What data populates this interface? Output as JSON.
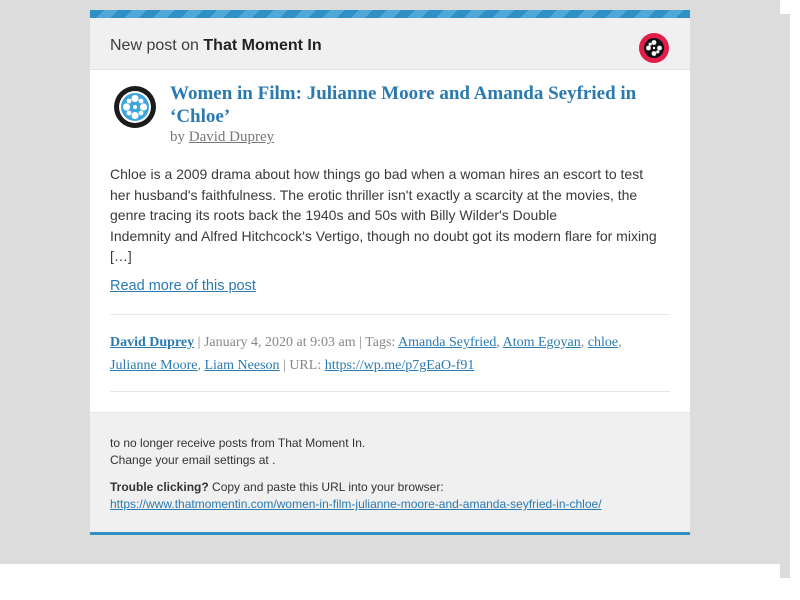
{
  "header": {
    "prefix": "New post on",
    "site_name": "That Moment In",
    "site_icon": "film-reel-icon"
  },
  "post": {
    "icon": "film-reel-icon",
    "title": "Women in Film: Julianne Moore and Amanda Seyfried in ‘Chloe’",
    "by": "by",
    "author": "David Duprey",
    "excerpt_lines": [
      "Chloe is a 2009 drama about how things go bad when a woman hires an escort to test",
      "her husband's faithfulness. The erotic thriller isn't exactly a scarcity at the movies, the",
      "genre tracing its roots back the 1940s and 50s with Billy Wilder's Double",
      "Indemnity and Alfred Hitchcock's Vertigo, though no doubt got its modern flare for mixing",
      "[…]"
    ],
    "read_more": "Read more of this post"
  },
  "meta": {
    "author": "David Duprey",
    "sep1": " | ",
    "date": "January 4, 2020 at 9:03 am",
    "tags_label": " | Tags: ",
    "tags": [
      "Amanda Seyfried",
      "Atom Egoyan",
      "chloe",
      "Julianne Moore",
      "Liam Neeson"
    ],
    "url_label": " | URL: ",
    "url": "https://wp.me/p7gEaO-f91"
  },
  "footer": {
    "unsubscribe": "to no longer receive posts from That Moment In.",
    "settings": "Change your email settings at .",
    "trouble_label": "Trouble clicking?",
    "trouble_text": " Copy and paste this URL into your browser:",
    "post_url": "https://www.thatmomentin.com/women-in-film-julianne-moore-and-amanda-seyfried-in-chloe/"
  },
  "colors": {
    "accent": "#2a7ab0",
    "bar": "#2e90c4",
    "site_icon_bg": "#e11d48"
  }
}
